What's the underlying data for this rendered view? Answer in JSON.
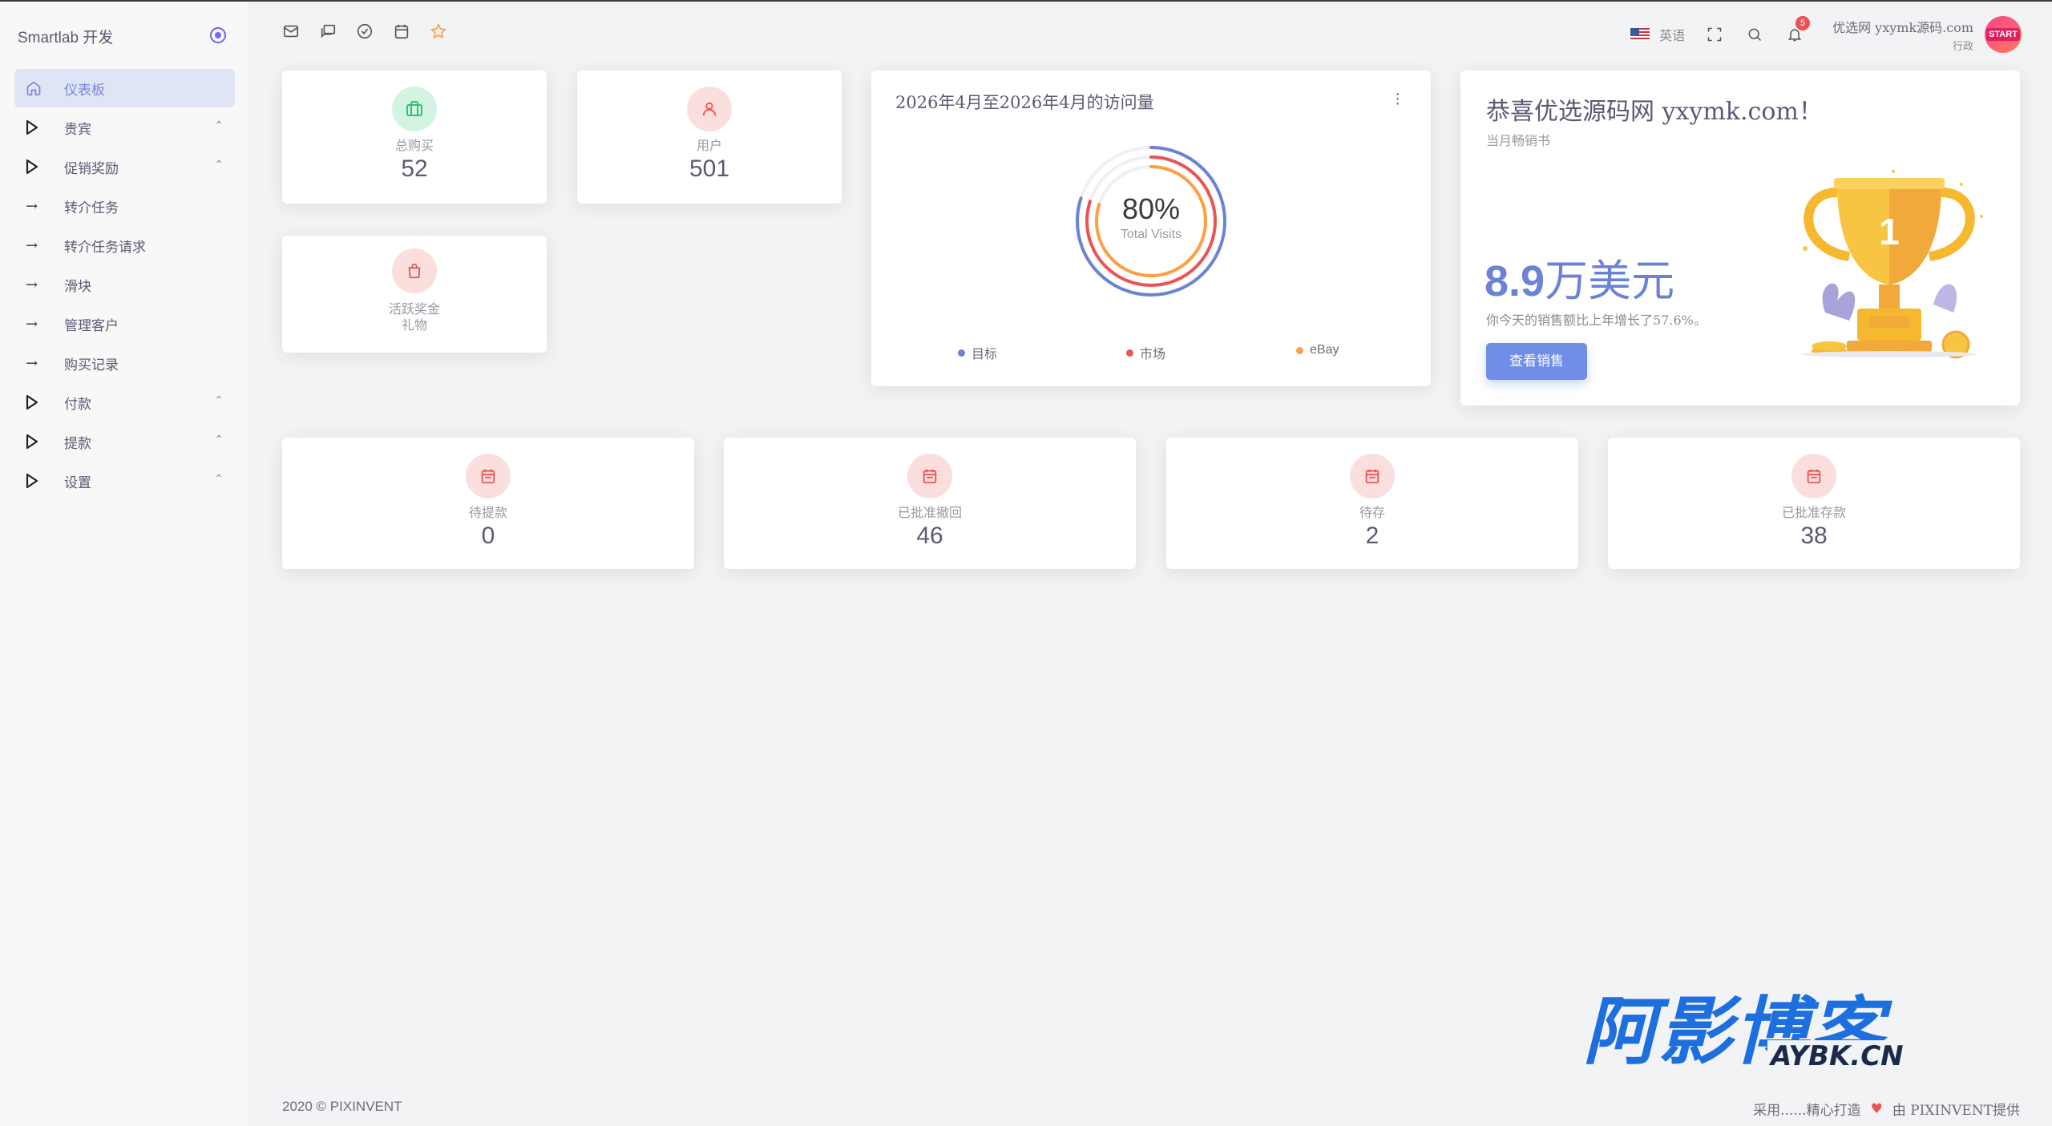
{
  "sidebar": {
    "brand": "Smartlab 开发",
    "items": [
      {
        "label": "仪表板",
        "icon": "home-icon",
        "active": true
      },
      {
        "label": "贵宾",
        "icon": "triangle-right-icon",
        "expandable": true
      },
      {
        "label": "促销奖励",
        "icon": "triangle-right-icon",
        "expandable": true
      },
      {
        "label": "转介任务",
        "icon": "arrow-right-icon"
      },
      {
        "label": "转介任务请求",
        "icon": "arrow-right-icon"
      },
      {
        "label": "滑块",
        "icon": "arrow-right-icon"
      },
      {
        "label": "管理客户",
        "icon": "arrow-right-icon"
      },
      {
        "label": "购买记录",
        "icon": "arrow-right-icon"
      },
      {
        "label": "付款",
        "icon": "triangle-right-icon",
        "expandable": true
      },
      {
        "label": "提款",
        "icon": "triangle-right-icon",
        "expandable": true
      },
      {
        "label": "设置",
        "icon": "triangle-right-icon",
        "expandable": true
      }
    ]
  },
  "header": {
    "shortcut_icons": [
      "mail-icon",
      "chat-icon",
      "check-circle-icon",
      "calendar-icon",
      "star-icon"
    ],
    "language": "英语",
    "notification_count": "5",
    "user_name": "优选网 yxymk源码.com",
    "user_role": "行政",
    "avatar_text": "START"
  },
  "stats_top": [
    {
      "label": "总购买",
      "value": "52",
      "icon": "briefcase-icon",
      "color": "#28c76f"
    },
    {
      "label": "用户",
      "value": "501",
      "icon": "user-icon",
      "color": "#ea5455"
    },
    {
      "label": "活跃奖金",
      "label2": "礼物",
      "icon": "bag-icon",
      "color": "#ea5455"
    }
  ],
  "visits": {
    "title": "2026年4月至2026年4月的访问量",
    "percent": "80%",
    "sub": "Total Visits",
    "legend": [
      {
        "label": "目标",
        "color": "#6b83d6"
      },
      {
        "label": "市场",
        "color": "#ea5455"
      },
      {
        "label": "eBay",
        "color": "#ff9f43"
      }
    ],
    "chart_data": {
      "type": "radialBar",
      "series": [
        {
          "name": "目标",
          "value": 80
        },
        {
          "name": "市场",
          "value": 80
        },
        {
          "name": "eBay",
          "value": 80
        }
      ]
    }
  },
  "congrats": {
    "title": "恭喜优选源码网 yxymk.com！",
    "subtitle": "当月畅销书",
    "amount_number": "8.9",
    "amount_unit": "万美元",
    "description": "你今天的销售额比上年增长了57.6%。",
    "button": "查看销售"
  },
  "stats_bottom": [
    {
      "label": "待提款",
      "value": "0",
      "icon": "calendar-icon"
    },
    {
      "label": "已批准撤回",
      "value": "46",
      "icon": "calendar-icon"
    },
    {
      "label": "待存",
      "value": "2",
      "icon": "calendar-icon"
    },
    {
      "label": "已批准存款",
      "value": "38",
      "icon": "calendar-icon"
    }
  ],
  "footer": {
    "copyright": "2020 © PIXINVENT",
    "credit_left": "采用......精心打造",
    "credit_right": "由 PIXINVENT提供"
  },
  "watermark": {
    "main": "阿影博客",
    "sub": "AYBK.CN"
  }
}
